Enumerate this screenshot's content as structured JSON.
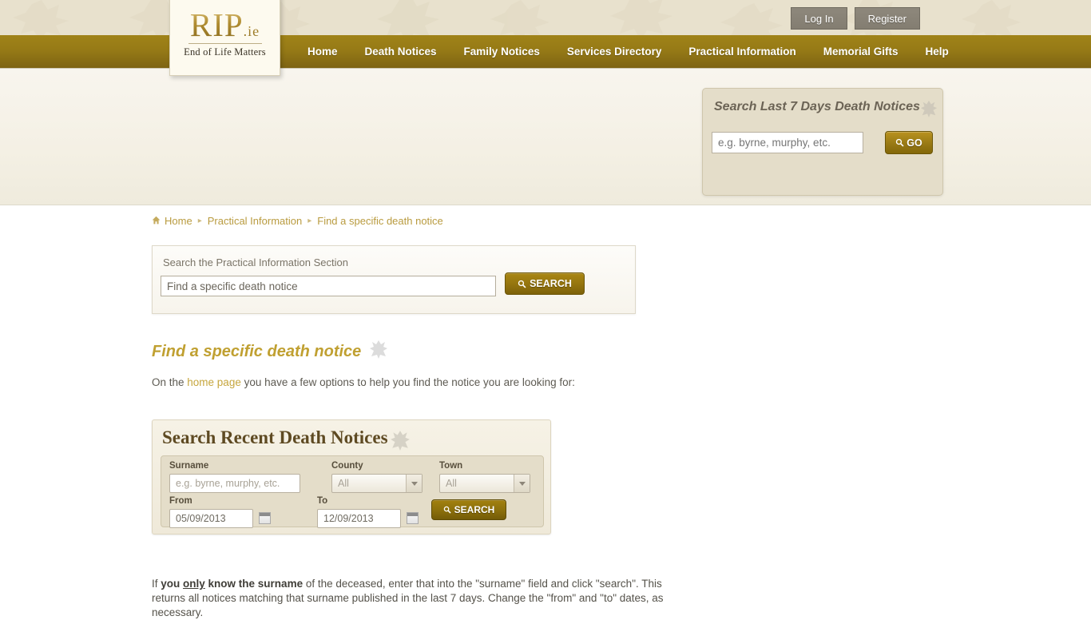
{
  "site": {
    "logo_main": "RIP",
    "logo_tld": ".ie",
    "logo_tagline": "End of Life Matters"
  },
  "auth": {
    "login_label": "Log In",
    "register_label": "Register"
  },
  "nav": {
    "items": [
      {
        "label": "Home"
      },
      {
        "label": "Death Notices"
      },
      {
        "label": "Family Notices"
      },
      {
        "label": "Services Directory"
      },
      {
        "label": "Practical Information"
      },
      {
        "label": "Memorial Gifts"
      },
      {
        "label": "Help"
      }
    ]
  },
  "quick_search": {
    "title": "Search Last 7 Days Death Notices",
    "input_placeholder": "e.g. byrne, murphy, etc.",
    "input_value": "",
    "go_label": "GO",
    "leaf_icon": "leaf-icon",
    "search_icon": "search-icon"
  },
  "breadcrumb": {
    "home_icon": "home-icon",
    "items": [
      {
        "label": "Home"
      },
      {
        "label": "Practical Information"
      },
      {
        "label": "Find a specific death notice"
      }
    ],
    "separator": "▸"
  },
  "section_search": {
    "label": "Search the Practical Information Section",
    "input_value": "Find a specific death notice",
    "input_placeholder": "Find a specific death notice",
    "button_label": "SEARCH",
    "search_icon": "search-icon"
  },
  "page": {
    "heading": "Find a specific death notice",
    "heading_leaf_icon": "leaf-icon",
    "intro_before": "On the ",
    "intro_link": "home page",
    "intro_after": " you have a few options to help you find the notice you are looking for:"
  },
  "widget": {
    "title": "Search Recent Death Notices",
    "leaf_icon": "leaf-icon",
    "surname_label": "Surname",
    "surname_placeholder": "e.g. byrne, murphy, etc.",
    "county_label": "County",
    "county_value": "All",
    "town_label": "Town",
    "town_value": "All",
    "from_label": "From",
    "from_value": "05/09/2013",
    "to_label": "To",
    "to_value": "12/09/2013",
    "search_label": "SEARCH",
    "search_icon": "search-icon",
    "calendar_icon": "calendar-icon",
    "dropdown_icon": "chevron-down-icon"
  },
  "body": {
    "p1_a": "If ",
    "p1_bold_a": "you ",
    "p1_bold_u": "only",
    "p1_bold_b": " know the surname",
    "p1_b": " of the deceased, enter that into the \"surname\" field and click \"search\". This returns all notices matching that surname published in the last 7 days. Change the \"from\" and \"to\" dates, as necessary."
  },
  "colors": {
    "nav_gold": "#967a16",
    "accent_gold": "#c0a031",
    "header_beige": "#e8e1cd",
    "panel_tan": "#e4ddc9",
    "auth_gray": "#837d71"
  }
}
